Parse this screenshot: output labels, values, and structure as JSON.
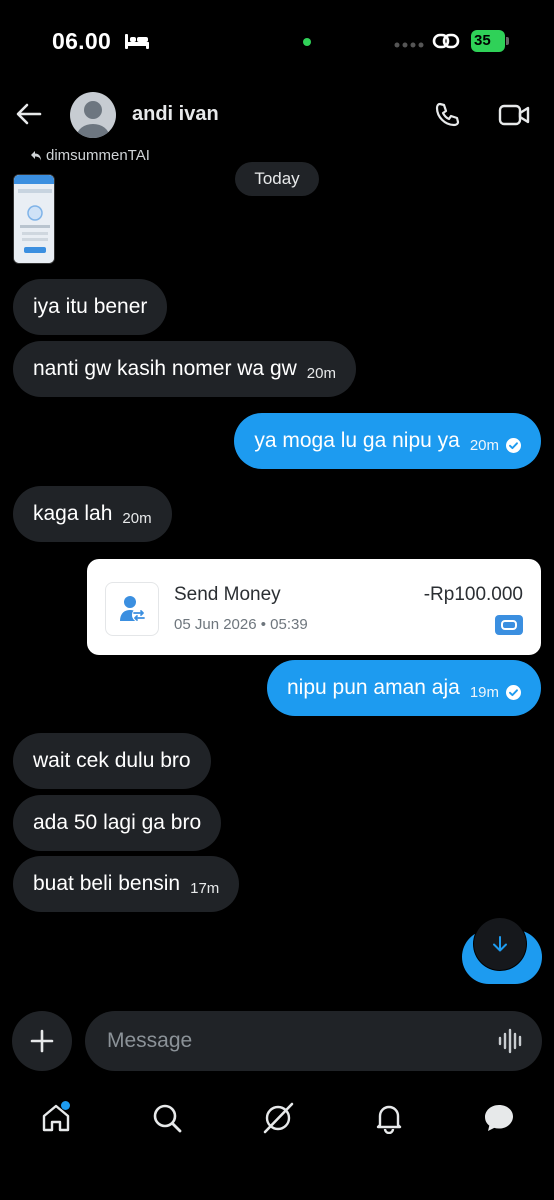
{
  "status_bar": {
    "time": "06.00",
    "battery": "35"
  },
  "header": {
    "contact_name": "andi ivan"
  },
  "reply_reference": {
    "name": "dimsummenTAI"
  },
  "date_separator": "Today",
  "messages": [
    {
      "text": "iya itu bener",
      "time": ""
    },
    {
      "text": "nanti gw kasih nomer wa gw",
      "time": "20m"
    },
    {
      "text": "ya moga lu ga nipu ya",
      "time": "20m"
    },
    {
      "text": "kaga lah",
      "time": "20m"
    },
    {
      "text": "nipu pun aman aja",
      "time": "19m"
    },
    {
      "text": "wait cek dulu bro",
      "time": ""
    },
    {
      "text": "ada 50 lagi ga bro",
      "time": ""
    },
    {
      "text": "buat beli bensin",
      "time": "17m"
    }
  ],
  "payment_card": {
    "title": "Send Money",
    "date": "05 Jun 2026 • 05:39",
    "amount": "-Rp100.000"
  },
  "composer": {
    "placeholder": "Message"
  },
  "colors": {
    "accent": "#1d9bf0",
    "incoming_bubble": "#202327",
    "background": "#000000",
    "battery": "#2fd158"
  },
  "icons": {
    "back": "arrow-left-icon",
    "call": "phone-icon",
    "video": "video-camera-icon",
    "add": "plus-icon",
    "voice": "waveform-icon",
    "scroll": "arrow-down-icon",
    "nav": [
      "home-icon",
      "search-icon",
      "grok-icon",
      "bell-icon",
      "messages-icon"
    ]
  }
}
